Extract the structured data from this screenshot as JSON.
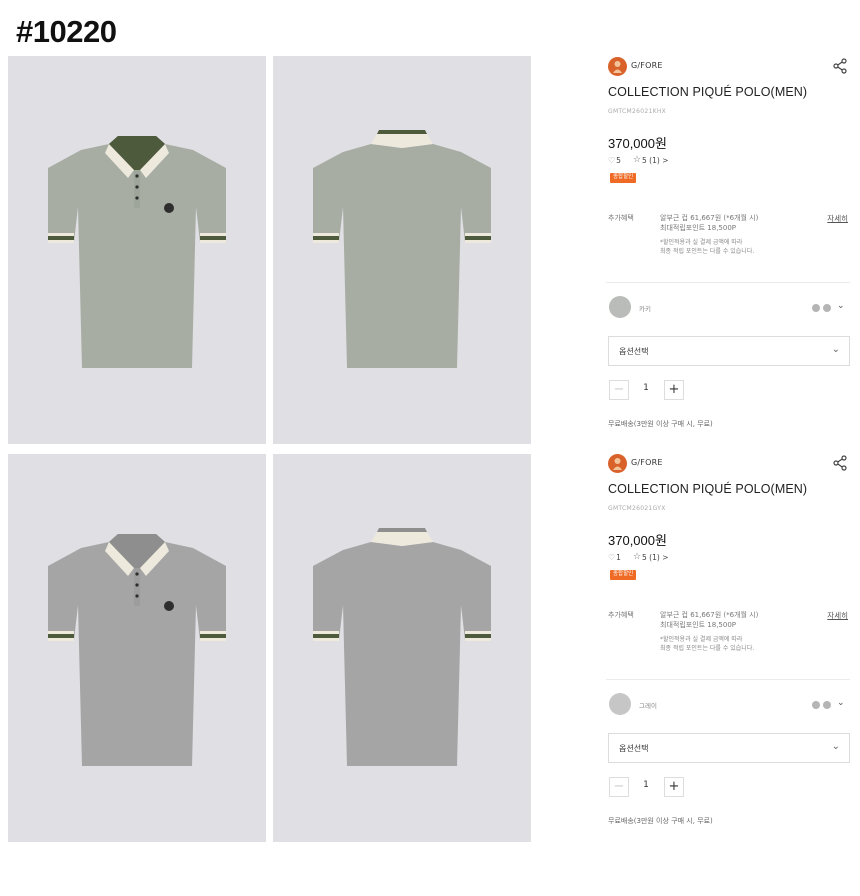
{
  "page": {
    "id_label": "#10220"
  },
  "colors": {
    "photo_bg": "#dfdfe4",
    "brand_accent": "#ef6a25",
    "green_grey_body": "#a7ada3",
    "heather_grey_body": "#a5a5a5",
    "khaki_trim": "#4e5a3c",
    "cream_trim": "#ede9dd"
  },
  "gallery": [
    {
      "alt": "khaki polo front",
      "variant": "khaki",
      "view": "front"
    },
    {
      "alt": "khaki polo back",
      "variant": "khaki",
      "view": "back"
    },
    {
      "alt": "grey polo front",
      "variant": "grey",
      "view": "front"
    },
    {
      "alt": "grey polo back",
      "variant": "grey",
      "view": "back"
    }
  ],
  "products": [
    {
      "brand": "G/FORE",
      "title": "COLLECTION PIQUÉ POLO(MEN)",
      "code": "GMTCM26021KHX",
      "price": "370,000원",
      "likes": "5",
      "rating": "5 (1) >",
      "badge": "종합할인",
      "benefit_label": "추가혜택",
      "benefit_line1": "알부근 컵 61,667원 (*6개월 시)",
      "benefit_line2": "최대적립포인트 18,500P",
      "benefit_note1": "*할인적용과 실 결제 금액에 따라",
      "benefit_note2": "최종 적립 포인트는 다를 수 있습니다.",
      "detail_link": "자세히",
      "color_name": "카키",
      "option_placeholder": "옵션선택",
      "quantity": "1",
      "shipping": "무료배송(3만원 이상 구매 시, 무료)",
      "swatch_color": "#b9bcb8",
      "icons": {
        "share": "share-icon",
        "heart": "heart-icon",
        "star": "star-icon",
        "chevron": "chevron-down-icon"
      }
    },
    {
      "brand": "G/FORE",
      "title": "COLLECTION PIQUÉ POLO(MEN)",
      "code": "GMTCM26021GYX",
      "price": "370,000원",
      "likes": "1",
      "rating": "5 (1) >",
      "badge": "종합할인",
      "benefit_label": "추가혜택",
      "benefit_line1": "알부근 컵 61,667원 (*6개월 시)",
      "benefit_line2": "최대적립포인트 18,500P",
      "benefit_note1": "*할인적용과 실 결제 금액에 따라",
      "benefit_note2": "최종 적립 포인트는 다를 수 있습니다.",
      "detail_link": "자세히",
      "color_name": "그레이",
      "option_placeholder": "옵션선택",
      "quantity": "1",
      "shipping": "무료배송(3만원 이상 구매 시, 무료)",
      "swatch_color": "#c6c6c6",
      "icons": {
        "share": "share-icon",
        "heart": "heart-icon",
        "star": "star-icon",
        "chevron": "chevron-down-icon"
      }
    }
  ]
}
